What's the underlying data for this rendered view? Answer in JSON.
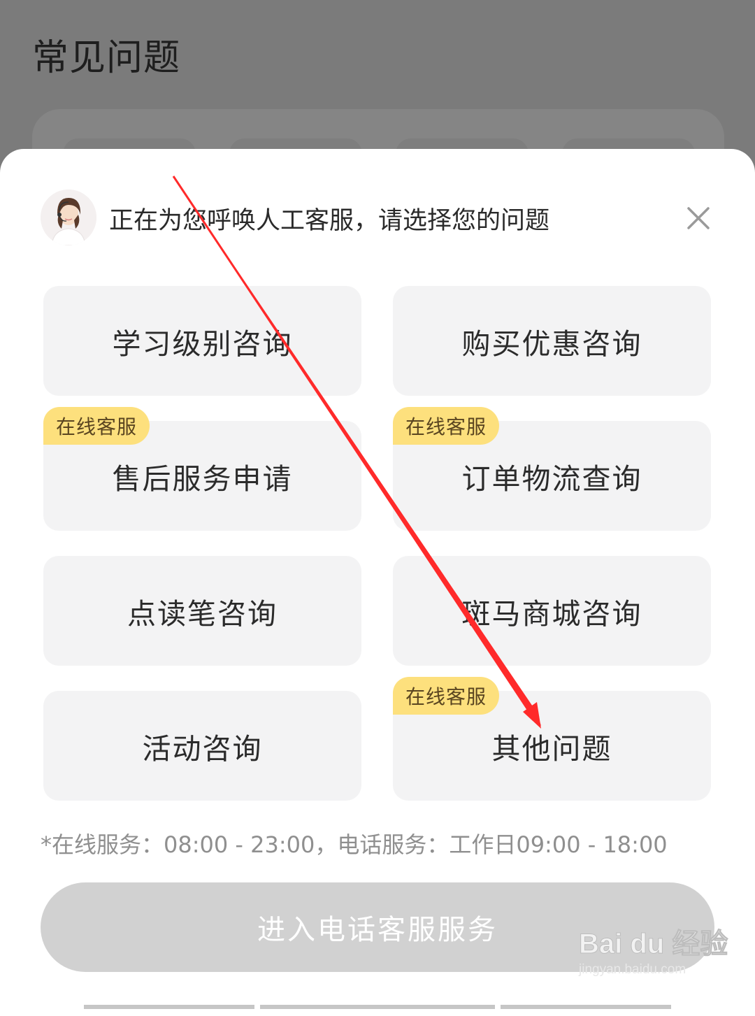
{
  "background": {
    "title": "常见问题"
  },
  "dialog": {
    "header_text": "正在为您呼唤人工客服，请选择您的问题",
    "avatar_icon": "agent-avatar",
    "close_icon": "close-icon",
    "options": [
      {
        "label": "学习级别咨询",
        "badge": ""
      },
      {
        "label": "购买优惠咨询",
        "badge": ""
      },
      {
        "label": "售后服务申请",
        "badge": "在线客服"
      },
      {
        "label": "订单物流查询",
        "badge": "在线客服"
      },
      {
        "label": "点读笔咨询",
        "badge": ""
      },
      {
        "label": "斑马商城咨询",
        "badge": ""
      },
      {
        "label": "活动咨询",
        "badge": ""
      },
      {
        "label": "其他问题",
        "badge": "在线客服"
      }
    ],
    "service_hours": "*在线服务：08:00 - 23:00，电话服务：工作日09:00 - 18:00",
    "phone_button_label": "进入电话客服服务"
  },
  "watermark": {
    "main": "Bai du 经验",
    "sub": "jingyan.baidu.com"
  },
  "colors": {
    "overlay": "#7b7b7b",
    "badge": "#fde07d",
    "option_bg": "#f3f3f4",
    "arrow": "#ff2a2a",
    "button_disabled": "#d1d1d1"
  }
}
